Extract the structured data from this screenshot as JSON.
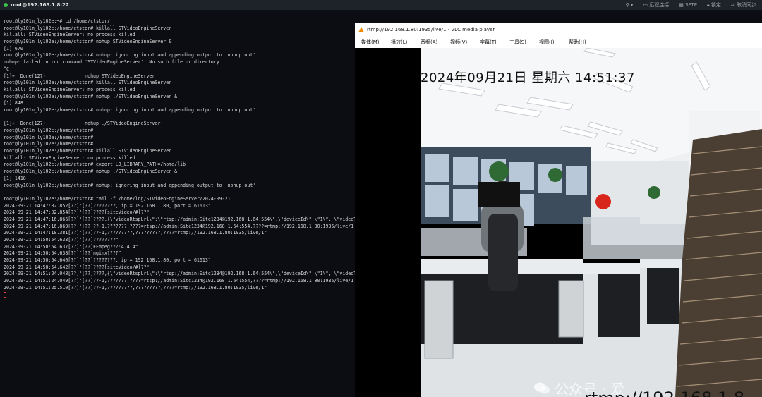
{
  "titlebar": {
    "host": "root@192.168.1.8:22",
    "remote_desktop": "远程连接",
    "sftp": "SFTP",
    "lock": "锁定",
    "cancel_sync": "取消同步"
  },
  "terminal": {
    "lines": [
      "root@ly101m_ly102e:~# cd /home/ctstor/",
      "root@ly101m_ly102e:/home/ctstor# killall STVideoEngineServer",
      "killall: STVideoEngineServer: no process killed",
      "root@ly101m_ly102e:/home/ctstor# nohup STVideoEngineServer &",
      "[1] 670",
      "root@ly101m_ly102e:/home/ctstor# nohup: ignoring input and appending output to 'nohup.out'",
      "nohup: failed to run command 'STVideoEngineServer': No such file or directory",
      "^C",
      "[1]+  Done(127)              nohup STVideoEngineServer",
      "root@ly101m_ly102e:/home/ctstor# killall STVideoEngineServer",
      "killall: STVideoEngineServer: no process killed",
      "root@ly101m_ly102e:/home/ctstor# nohup ./STVideoEngineServer &",
      "[1] 848",
      "root@ly101m_ly102e:/home/ctstor# nohup: ignoring input and appending output to 'nohup.out'",
      "",
      "[1]+  Done(127)              nohup ./STVideoEngineServer",
      "root@ly101m_ly102e:/home/ctstor#",
      "root@ly101m_ly102e:/home/ctstor#",
      "root@ly101m_ly102e:/home/ctstor#",
      "root@ly101m_ly102e:/home/ctstor# killall STVideoEngineServer",
      "killall: STVideoEngineServer: no process killed",
      "root@ly101m_ly102e:/home/ctstor# export LD_LIBRARY_PATH=/home/lib",
      "root@ly101m_ly102e:/home/ctstor# nohup ./STVideoEngineServer &",
      "[1] 1418",
      "root@ly101m_ly102e:/home/ctstor# nohup: ignoring input and appending output to 'nohup.out'",
      "",
      "root@ly101m_ly102e:/home/ctstor# tail -f /home/log/STVideoEngineServer/2024-09-21",
      "2024-09-21 14:47:02.852[??]\"[??]????????, ip = 192.168.1.80, port = 61613\"",
      "2024-09-21 14:47:02.854[??]\"[??]????[sitcVideo/#]??\"",
      "2024-09-21 14:47:16.866[??]\"[??]????,{\\\"videoRtspUrl\\\":\\\"rtsp://admin:Sitc1234@192.168.1.64:554\\\",\\\"deviceId\\\":\\\"1\\\", \\\"videoT",
      "2024-09-21 14:47:16.869[??]\"[??]??-1,???????,????=rtsp://admin:Sitc1234@192.168.1.64:554,????=rtmp://192.168.1.80:1935/live/1",
      "2024-09-21 14:47:18.381[??]\"[??]??-1,?????????,?????????,????=rtmp://192.168.1.80:1935/live/1\"",
      "2024-09-21 14:50:54.633[??]\"[??]????????\"",
      "2024-09-21 14:50:54.637[??]\"[??]FFmpeg???:4.4.4\"",
      "2024-09-21 14:50:54.638[??]\"[??]nginx????\"",
      "2024-09-21 14:50:54.640[??]\"[??]????????, ip = 192.168.1.80, port = 61613\"",
      "2024-09-21 14:50:54.642[??]\"[??]????[sitcVideo/#]??\"",
      "2024-09-21 14:51:24.048[??]\"[??]????,{\\\"videoRtspUrl\\\":\\\"rtsp://admin:Sitc1234@192.168.1.64:554\\\",\\\"deviceId\\\":\\\"1\\\", \\\"videoT",
      "2024-09-21 14:51:24.049[??]\"[??]??-1,???????,????=rtsp://admin:Sitc1234@192.168.1.64:554,????=rtmp://192.168.1.80:1935/live/1",
      "2024-09-21 14:51:25.510[??]\"[??]??-1,?????????,?????????,????=rtmp://192.168.1.80:1935/live/1\""
    ]
  },
  "vlc": {
    "title": "rtmp://192.168.1.80:1935/live/1 - VLC media player",
    "menu": [
      "媒体(M)",
      "播放(L)",
      "音频(A)",
      "视频(V)",
      "字幕(T)",
      "工具(S)",
      "视图(I)",
      "帮助(H)"
    ],
    "osd_time": "2024年09月21日  星期六  14:51:37",
    "osd_url": "rtmp://192.168.1.8",
    "watermark": "公众号 · 爱"
  }
}
